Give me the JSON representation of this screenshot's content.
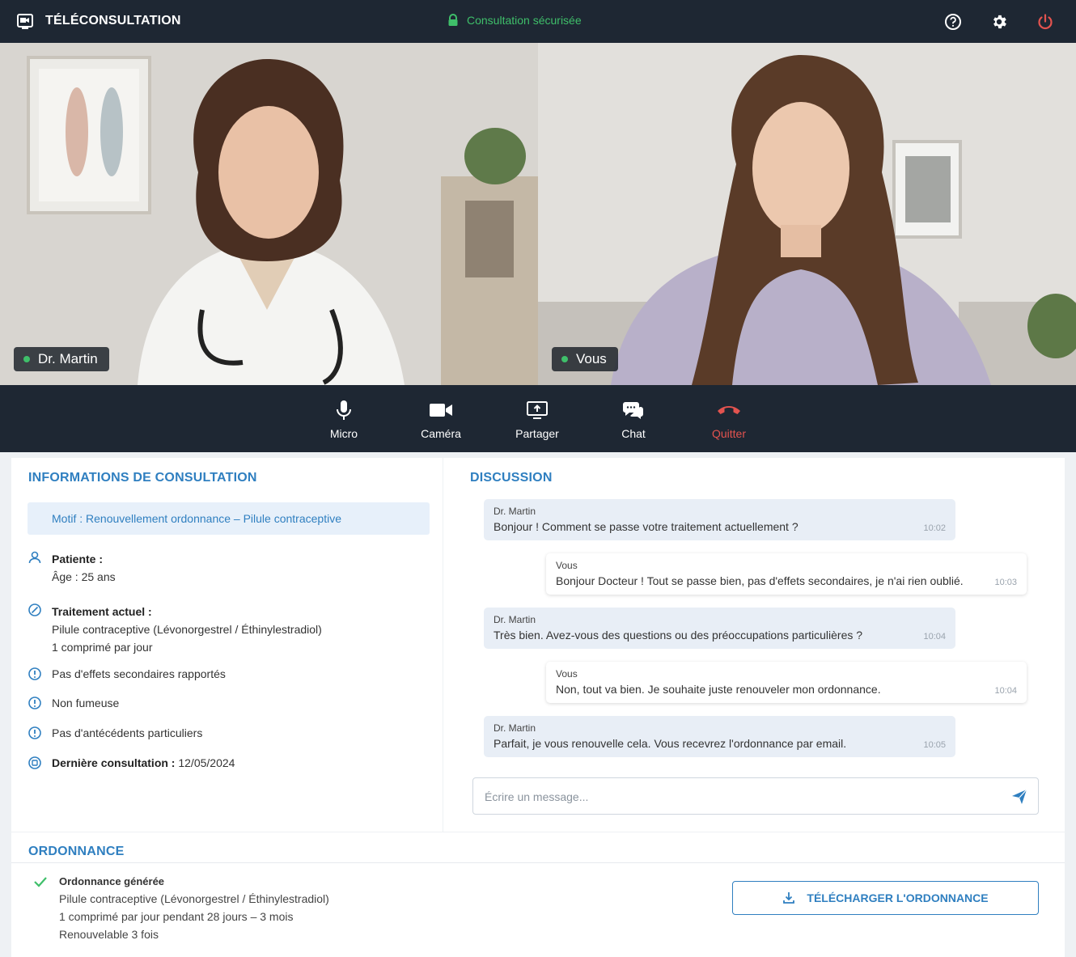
{
  "header": {
    "title": "TÉLÉCONSULTATION",
    "secure_label": "Consultation sécurisée",
    "icons": [
      "app-video-icon",
      "help-icon",
      "settings-icon",
      "power-icon"
    ],
    "secure_color": "#3fbf6a",
    "power_color": "#e3534f"
  },
  "video": {
    "doctor_name": "Dr. Martin",
    "self_name": "Vous"
  },
  "controls": {
    "items": [
      {
        "label": "Micro",
        "icon": "microphone-icon"
      },
      {
        "label": "Caméra",
        "icon": "camera-icon"
      },
      {
        "label": "Partager",
        "icon": "screen-share-icon"
      },
      {
        "label": "Chat",
        "icon": "chat-icon"
      },
      {
        "label": "Quitter",
        "icon": "hang-up-icon"
      }
    ]
  },
  "info": {
    "title": "INFORMATIONS DE CONSULTATION",
    "motif": "Motif : Renouvellement ordonnance – Pilule contraceptive",
    "patient_label": "Patiente :",
    "patient_age": "Âge : 25 ans",
    "treatment_label": "Traitement actuel :",
    "treatment_line1": "Pilule contraceptive (Lévonorgestrel / Éthinylestradiol)",
    "treatment_line2": "1 comprimé par jour",
    "no_side_effects": "Pas d'effets secondaires rapportés",
    "non_smoker": "Non fumeuse",
    "no_history": "Pas d'antécédents particuliers",
    "last_label": "Dernière consultation :",
    "last_date": "12/05/2024"
  },
  "chat": {
    "title": "DISCUSSION",
    "messages": [
      {
        "author": "Dr. Martin",
        "text": "Bonjour ! Comment se passe votre traitement actuellement ?",
        "time": "10:02"
      },
      {
        "author": "Vous",
        "text": "Bonjour Docteur ! Tout se passe bien, pas d'effets secondaires, je n'ai rien oublié.",
        "time": "10:03"
      },
      {
        "author": "Dr. Martin",
        "text": "Très bien. Avez-vous des questions ou des préoccupations particulières ?",
        "time": "10:04"
      },
      {
        "author": "Vous",
        "text": "Non, tout va bien. Je souhaite juste renouveler mon ordonnance.",
        "time": "10:04"
      },
      {
        "author": "Dr. Martin",
        "text": "Parfait, je vous renouvelle cela. Vous recevrez l'ordonnance par email.",
        "time": "10:05"
      }
    ],
    "placeholder": "Écrire un message...",
    "input_value": ""
  },
  "prescription": {
    "title": "ORDONNANCE",
    "status": "Ordonnance générée",
    "line1": "Pilule contraceptive (Lévonorgestrel / Éthinylestradiol)",
    "line2": "1 comprimé par jour pendant 28 jours – 3 mois",
    "line3": "Renouvelable 3 fois",
    "download_label": "TÉLÉCHARGER L'ORDONNANCE"
  }
}
